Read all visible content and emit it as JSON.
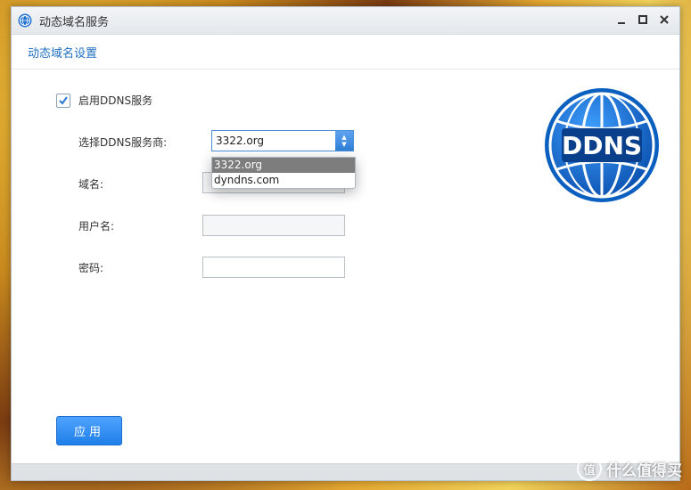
{
  "window": {
    "title": "动态域名服务",
    "minimize_icon": "minimize-icon",
    "maximize_icon": "maximize-icon",
    "close_icon": "close-icon"
  },
  "section": {
    "title": "动态域名设置"
  },
  "form": {
    "enable_checkbox": {
      "label": "启用DDNS服务",
      "checked": true
    },
    "provider": {
      "label": "选择DDNS服务商:",
      "value": "3322.org",
      "options": [
        "3322.org",
        "dyndns.com"
      ],
      "selected_index": 0
    },
    "domain": {
      "label": "域名:",
      "value": ""
    },
    "username": {
      "label": "用户名:",
      "value": ""
    },
    "password": {
      "label": "密码:",
      "value": ""
    }
  },
  "logo": {
    "text": "DDNS"
  },
  "apply_button": {
    "label": "应用"
  },
  "watermark": {
    "text": "什么值得买",
    "icon_text": "值"
  },
  "colors": {
    "accent": "#1f7fe8",
    "link": "#1f6fc2",
    "logo_blue": "#0a5fbf"
  }
}
